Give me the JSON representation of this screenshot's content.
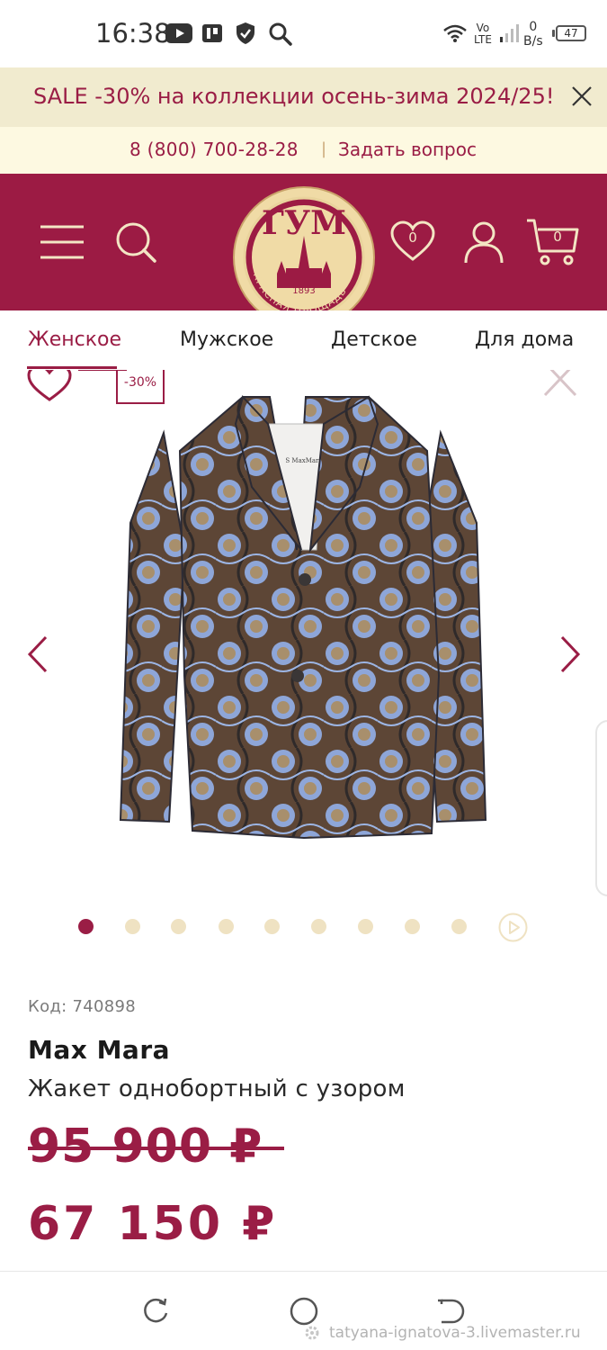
{
  "status_bar": {
    "time": "16:38",
    "network_speed_value": "0",
    "network_speed_unit": "B/s",
    "lte_top": "Vo",
    "lte_bottom": "LTE",
    "battery": "47"
  },
  "promo": {
    "text": "SALE -30% на коллекции осень-зима 2024/25!"
  },
  "contact": {
    "phone": "8 (800) 700-28-28",
    "separator": "|",
    "ask": "Задать вопрос"
  },
  "header": {
    "wishlist_count": "0",
    "cart_count": "0",
    "logo": {
      "letters": "ГУМ",
      "year": "1893",
      "ring_text": "КРАСНАЯ ПЛОЩАДЬ"
    }
  },
  "categories": [
    {
      "label": "Женское",
      "active": true
    },
    {
      "label": "Мужское",
      "active": false
    },
    {
      "label": "Детское",
      "active": false
    },
    {
      "label": "Для дома",
      "active": false
    }
  ],
  "gallery": {
    "discount_badge": "-30%",
    "jacket_label_text": "S MaxMara",
    "image_count": 9,
    "active_index": 0,
    "has_video": true
  },
  "product": {
    "code": "Код: 740898",
    "brand": "Max Mara",
    "name": "Жакет однобортный с узором",
    "old_price": "95 900 ₽",
    "new_price": "67 150 ₽"
  },
  "watermark": "tatyana-ignatova-3.livemaster.ru",
  "colors": {
    "brand": "#9c1b44",
    "promo_bg": "#f1ebcf",
    "contact_bg": "#fdf9e1",
    "gold": "#e9d39c",
    "dot_inactive": "#efe2c2"
  }
}
